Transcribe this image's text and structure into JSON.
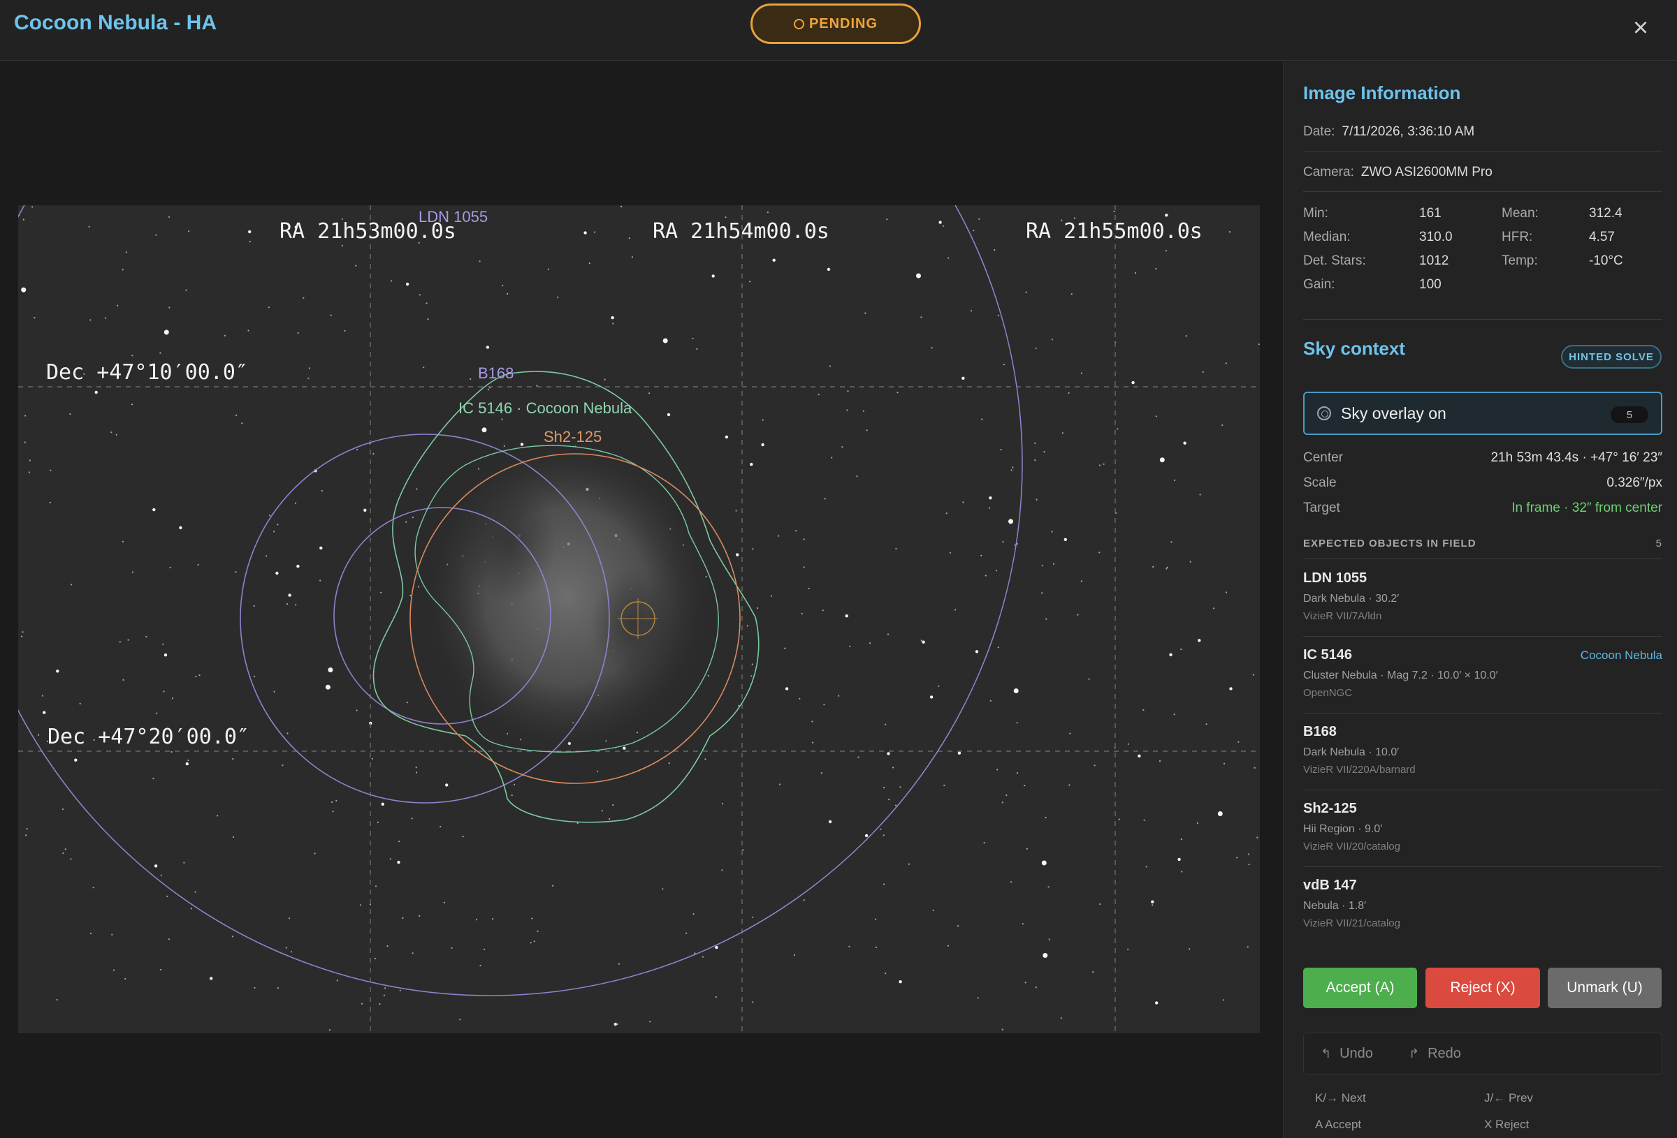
{
  "header": {
    "title": "Cocoon Nebula - HA",
    "status": "PENDING",
    "close_icon": "×"
  },
  "overlay": {
    "ra_labels": [
      "RA 21h53m00.0s",
      "RA 21h54m00.0s",
      "RA 21h55m00.0s"
    ],
    "dec_labels": [
      "Dec +47°10′00.0″",
      "Dec +47°20′00.0″"
    ],
    "objects": {
      "ldn": "LDN 1055",
      "b168": "B168",
      "ic5146": "IC 5146 · Cocoon Nebula",
      "sh2": "Sh2-125"
    },
    "colors": {
      "ldn": "#a89ae6",
      "b168": "#a89ae6",
      "ic5146": "#8fd6b0",
      "sh2": "#e39b6a"
    }
  },
  "image_info": {
    "title": "Image Information",
    "date_label": "Date:",
    "date": "7/11/2026, 3:36:10 AM",
    "camera_label": "Camera:",
    "camera": "ZWO ASI2600MM Pro",
    "stats": {
      "min_label": "Min:",
      "min": "161",
      "mean_label": "Mean:",
      "mean": "312.4",
      "median_label": "Median:",
      "median": "310.0",
      "hfr_label": "HFR:",
      "hfr": "4.57",
      "stars_label": "Det. Stars:",
      "stars": "1012",
      "temp_label": "Temp:",
      "temp": "-10°C",
      "gain_label": "Gain:",
      "gain": "100"
    }
  },
  "sky_context": {
    "title": "Sky context",
    "badge": "HINTED SOLVE",
    "toggle_label": "Sky overlay on",
    "toggle_count": "5",
    "center_label": "Center",
    "center": "21h 53m 43.4s · +47° 16′ 23″",
    "scale_label": "Scale",
    "scale": "0.326″/px",
    "target_label": "Target",
    "target": "In frame · 32″ from center",
    "expected_label": "EXPECTED OBJECTS IN FIELD",
    "expected_count": "5",
    "items": [
      {
        "name": "LDN 1055",
        "alias": "",
        "desc": "Dark Nebula · 30.2′",
        "source": "VizieR VII/7A/ldn"
      },
      {
        "name": "IC 5146",
        "alias": "Cocoon Nebula",
        "desc": "Cluster Nebula · Mag 7.2 · 10.0′ × 10.0′",
        "source": "OpenNGC"
      },
      {
        "name": "B168",
        "alias": "",
        "desc": "Dark Nebula · 10.0′",
        "source": "VizieR VII/220A/barnard"
      },
      {
        "name": "Sh2-125",
        "alias": "",
        "desc": "Hii Region · 9.0′",
        "source": "VizieR VII/20/catalog"
      },
      {
        "name": "vdB 147",
        "alias": "",
        "desc": "Nebula · 1.8′",
        "source": "VizieR VII/21/catalog"
      }
    ]
  },
  "actions": {
    "accept": "Accept (A)",
    "reject": "Reject (X)",
    "unmark": "Unmark (U)",
    "undo": "Undo",
    "redo": "Redo"
  },
  "shortcuts": {
    "next": "K/→ Next",
    "prev": "J/← Prev",
    "accept": "A Accept",
    "reject": "X Reject"
  }
}
